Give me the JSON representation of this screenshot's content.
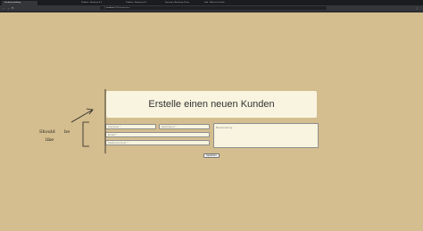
{
  "browser": {
    "tabs": [
      {
        "label": "Kundenverwaltung"
      },
      {
        "label": "Problem - Bootstrap 4.0"
      },
      {
        "label": "Problem - Bootstrap 4.0"
      },
      {
        "label": "Spacing in Bootstrap 4 form"
      },
      {
        "label": "html - Make text stretch"
      }
    ],
    "url_host": "localhost",
    "url_path": ":4200/kunden/neu"
  },
  "page": {
    "title": "Erstelle einen neuen Kunden",
    "fields": {
      "vorname_placeholder": "Vorname *",
      "nachname_placeholder": "Nachname *",
      "email_placeholder": "Email *",
      "telefon_placeholder": "Telefonnummer *",
      "beschreibung_placeholder": "Beschreibung"
    },
    "save_label": "Speichern"
  },
  "annotation": {
    "line1": "Should",
    "line2": "be",
    "line3": "like"
  },
  "colors": {
    "page_bg": "#d4bd8e",
    "card_bg": "#f8f4df",
    "chrome_dark": "#1b1c1f"
  }
}
